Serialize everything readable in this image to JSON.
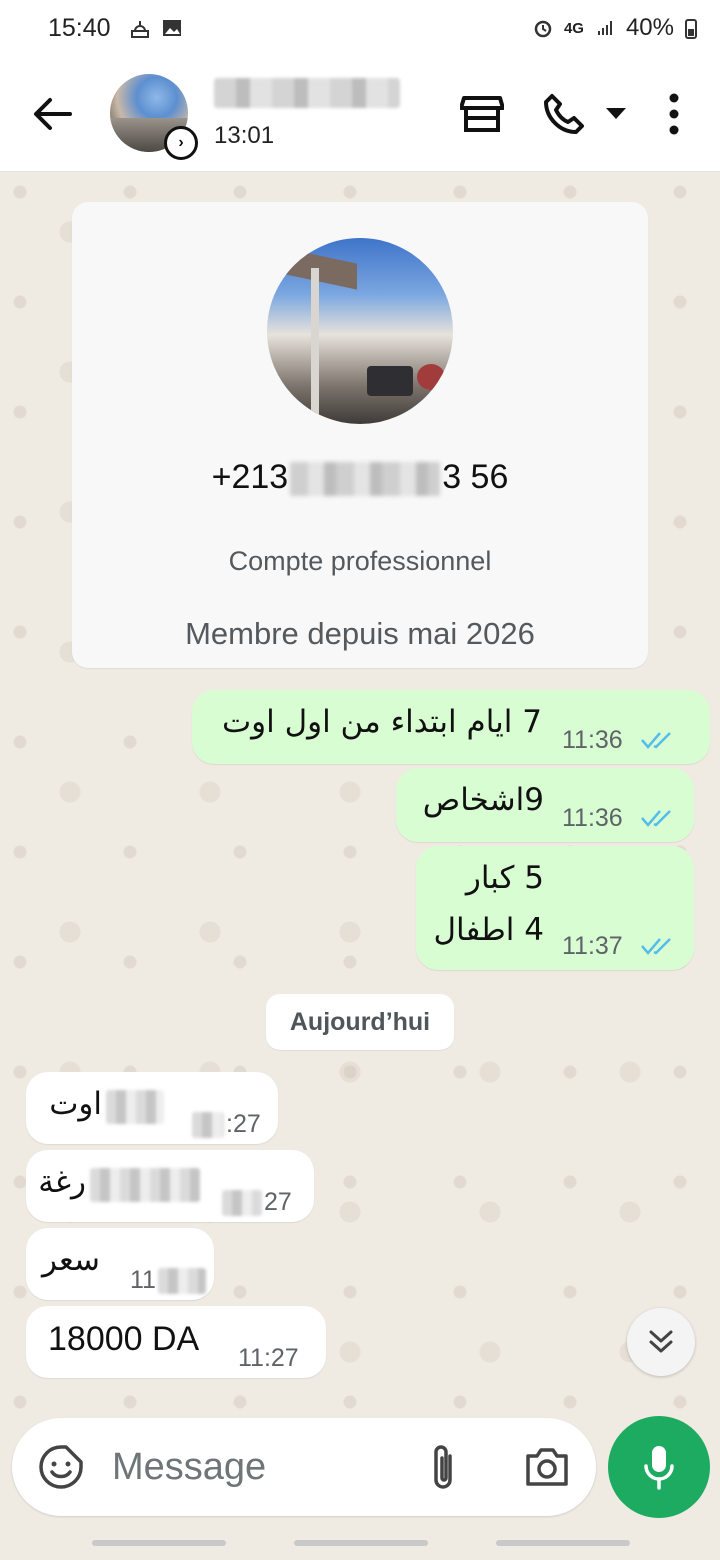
{
  "status_bar": {
    "time": "15:40",
    "network": "4G",
    "battery": "40%",
    "icons": [
      "mosque-icon",
      "gallery-icon",
      "alarm-icon",
      "data-arrows-icon",
      "signal-icon",
      "battery-charging-icon"
    ]
  },
  "header": {
    "last_seen": "13:01",
    "icons": [
      "back-arrow-icon",
      "store-icon",
      "phone-icon",
      "chevron-down-icon",
      "more-vert-icon"
    ]
  },
  "info_card": {
    "phone_prefix": "+213",
    "phone_suffix": "3 56",
    "account_type": "Compte professionnel",
    "member_since": "Membre depuis mai 2026"
  },
  "messages": [
    {
      "direction": "out",
      "text": "7 ايام ابتداء من اول اوت",
      "time": "11:36",
      "status": "read"
    },
    {
      "direction": "out",
      "text": "9اشخاص",
      "time": "11:36",
      "status": "read"
    },
    {
      "direction": "out",
      "line1": "5 كبار",
      "line2": "4 اطفال",
      "time": "11:37",
      "status": "read"
    },
    {
      "direction": "in",
      "text": "اوت",
      "time": ":27"
    },
    {
      "direction": "in",
      "text": "رغة",
      "time": "27"
    },
    {
      "direction": "in",
      "text": "سعر",
      "time": "11"
    },
    {
      "direction": "in",
      "text": "18000 DA",
      "time": "11:27"
    }
  ],
  "date_divider": "Aujourd’hui",
  "composer": {
    "placeholder": "Message"
  },
  "colors": {
    "outgoing_bubble": "#d9fdd3",
    "incoming_bubble": "#ffffff",
    "read_ticks": "#53bdeb",
    "mic_button": "#1daa61",
    "chat_background": "#efeae2"
  }
}
